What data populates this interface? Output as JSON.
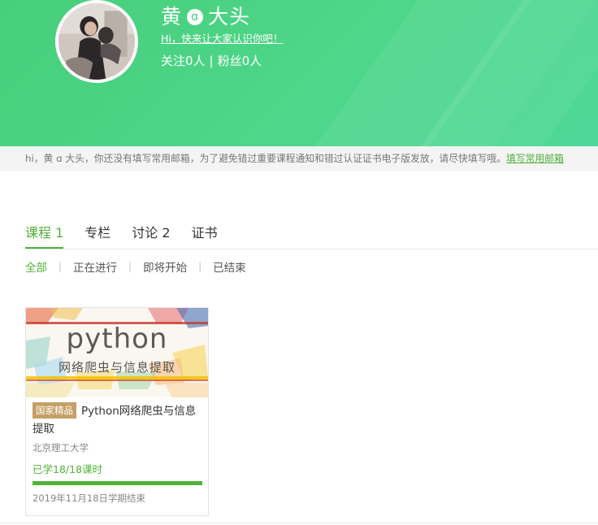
{
  "profile": {
    "name_part1": "黄",
    "name_mid": "ɑ",
    "name_part2": "大头",
    "intro": "Hi，快来让大家认识你吧！",
    "follow_label": "关注0人",
    "follow_sep": "|",
    "fans_label": "粉丝0人"
  },
  "notice": {
    "text": "hi，黄 ɑ 大头，你还没有填写常用邮箱，为了避免错过重要课程通知和错过认证证书电子版发放，请尽快填写哦。",
    "link": "填写常用邮箱"
  },
  "tabs": [
    {
      "label": "课程 1",
      "active": true
    },
    {
      "label": "专栏",
      "active": false
    },
    {
      "label": "讨论 2",
      "active": false
    },
    {
      "label": "证书",
      "active": false
    }
  ],
  "filters": [
    {
      "label": "全部",
      "active": true
    },
    {
      "label": "正在进行",
      "active": false
    },
    {
      "label": "即将开始",
      "active": false
    },
    {
      "label": "已结束",
      "active": false
    }
  ],
  "filter_sep": "|",
  "course": {
    "cover_title": "python",
    "cover_subtitle": "网络爬虫与信息提取",
    "badge": "国家精品",
    "title": "Python网络爬虫与信息提取",
    "school": "北京理工大学",
    "progress_text": "已学18/18课时",
    "progress": 1.0,
    "term": "2019年11月18日学期结束"
  },
  "colors": {
    "banner": "#4ed68a",
    "accent": "#52b13b",
    "badge": "#c79f66"
  }
}
